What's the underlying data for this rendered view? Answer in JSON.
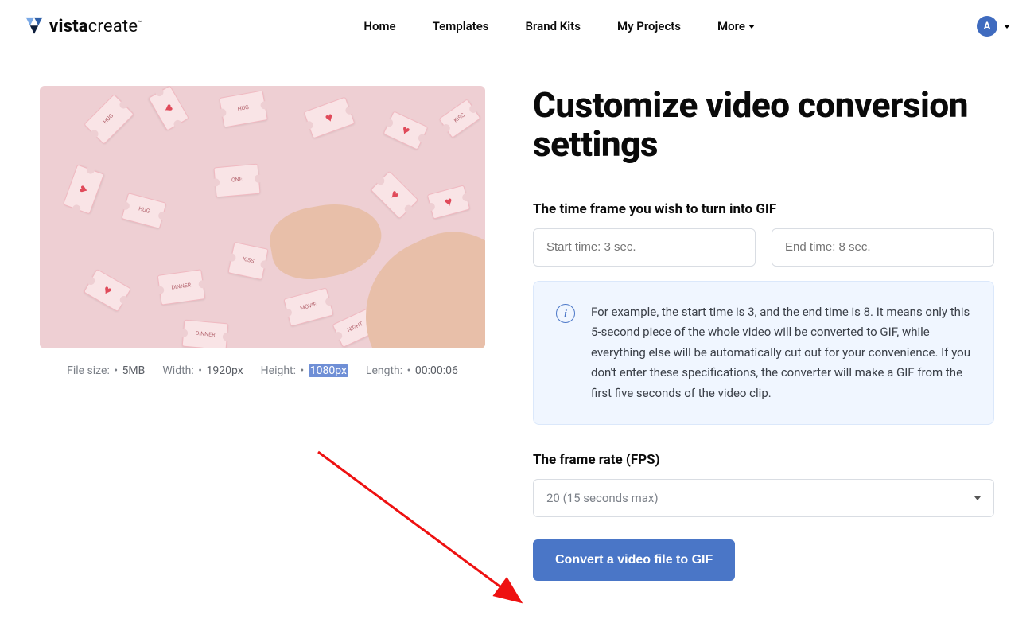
{
  "brand": {
    "bold": "vista",
    "light": "create",
    "tm": "™"
  },
  "nav": {
    "home": "Home",
    "templates": "Templates",
    "brand_kits": "Brand Kits",
    "my_projects": "My Projects",
    "more": "More"
  },
  "account": {
    "initial": "A"
  },
  "heading": "Customize video conversion settings",
  "timeframe": {
    "label": "The time frame you wish to turn into GIF",
    "start_placeholder": "Start time: 3 sec.",
    "end_placeholder": "End time: 8 sec."
  },
  "info_text": "For example, the start time is 3, and the end time is 8. It means only this 5-second piece of the whole video will be converted to GIF, while everything else will be automatically cut out for your convenience. If you don't enter these specifications, the converter will make a GIF from the first five seconds of the video clip.",
  "fps": {
    "label": "The frame rate (FPS)",
    "selected": "20 (15 seconds max)"
  },
  "convert_button": "Convert a video file to GIF",
  "meta": {
    "filesize_label": "File size:",
    "filesize_value": "5MB",
    "width_label": "Width:",
    "width_value": "1920px",
    "height_label": "Height:",
    "height_value": "1080px",
    "length_label": "Length:",
    "length_value": "00:00:06"
  }
}
